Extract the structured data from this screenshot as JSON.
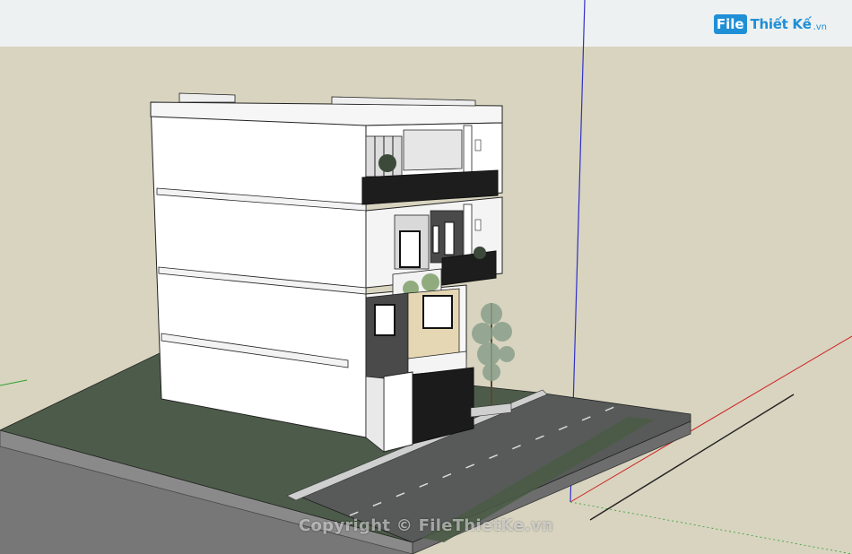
{
  "logo": {
    "box": "File",
    "name": "Thiết Kế",
    "tld": ".vn"
  },
  "watermark": "Copyright © FileThietKe.vn",
  "colors": {
    "sky": "#f0f2f1",
    "ground": "#d8d4c0",
    "grass": "#4a5a48",
    "road": "#575959",
    "facade": "#ffffff",
    "accent_wood": "#e8d9b8",
    "dark_panel": "#2a2a2a",
    "axis_blue": "#3030c8",
    "axis_red": "#d02020",
    "axis_green": "#30a030"
  }
}
